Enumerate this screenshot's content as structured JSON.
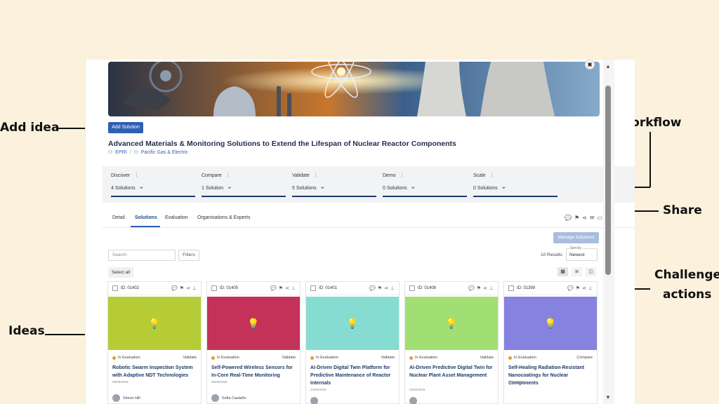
{
  "callouts": {
    "add_idea": "Add idea",
    "workflow": "Workflow",
    "share": "Share",
    "challenge_actions_1": "Challenge",
    "challenge_actions_2": "actions",
    "ideas": "Ideas"
  },
  "header": {
    "add_solution": "Add Solution",
    "title": "Advanced Materials & Monitoring Solutions to Extend the Lifespan of Nuclear Reactor Components",
    "org1": "EPRI",
    "org_sep": "/",
    "org2": "Pacific Gas & Electric"
  },
  "workflow": [
    {
      "name": "Discover",
      "count": "4 Solutions"
    },
    {
      "name": "Compare",
      "count": "1 Solution"
    },
    {
      "name": "Validate",
      "count": "5 Solutions"
    },
    {
      "name": "Demo",
      "count": "0 Solutions"
    },
    {
      "name": "Scale",
      "count": "0 Solutions"
    }
  ],
  "tabs": [
    "Detail",
    "Solutions",
    "Evaluation",
    "Organisations & Experts"
  ],
  "toolbar": {
    "manage_solutions": "Manage Solutions",
    "search_placeholder": "Search",
    "filters": "Filters",
    "results": "10 Results",
    "sort_label": "Sort by",
    "sort_value": "Newest",
    "select_all": "Select all"
  },
  "cards": [
    {
      "id": "ID: 01402",
      "color": "#b6cc36",
      "status": "In Evaluation",
      "stage": "Validate",
      "title": "Robotic Swarm Inspection System with Adaptive NDT Technologies",
      "date": "09/03/2026",
      "owner": "Simon Hill"
    },
    {
      "id": "ID: 01405",
      "color": "#c4325a",
      "status": "In Evaluation",
      "stage": "Validate",
      "title": "Self-Powered Wireless Sensors for In-Core Real-Time Monitoring",
      "date": "05/03/2026",
      "owner": "Sofia Castaño"
    },
    {
      "id": "ID: 01401",
      "color": "#86dcd1",
      "status": "In Evaluation",
      "stage": "Validate",
      "title": "AI-Driven Digital Twin Platform for Predictive Maintenance of Reactor Internals",
      "date": "24/02/2026",
      "owner": ""
    },
    {
      "id": "ID: 01408",
      "color": "#a1df74",
      "status": "In Evaluation",
      "stage": "Validate",
      "title": "AI-Driven Predictive Digital Twin for Nuclear Plant Asset Management",
      "date": "24/02/2026",
      "owner": ""
    },
    {
      "id": "ID: 01399",
      "color": "#8582e0",
      "status": "In Evaluation",
      "stage": "Compare",
      "title": "Self-Healing Radiation-Resistant Nanocoatings for Nuclear Components",
      "date": "16/02/2026",
      "owner": ""
    }
  ]
}
